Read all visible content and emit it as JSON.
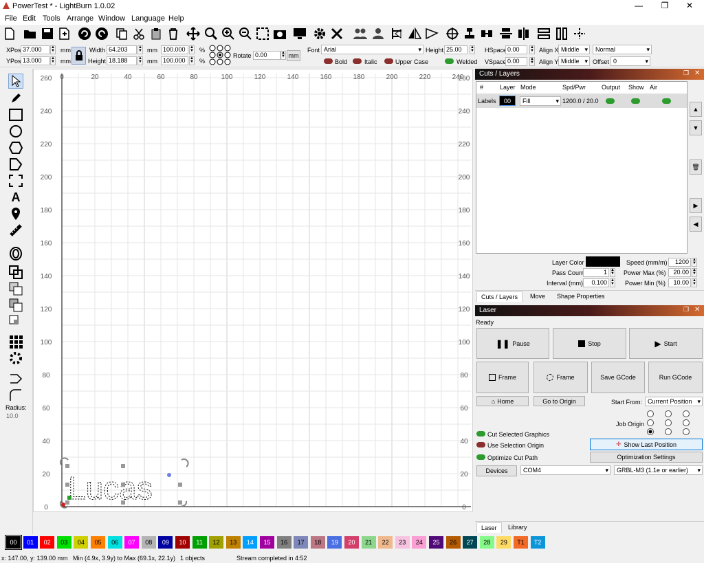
{
  "titlebar": {
    "title": "PowerTest * - LightBurn 1.0.02",
    "minimize": "—",
    "maximize": "❐",
    "close": "✕"
  },
  "menu": [
    "File",
    "Edit",
    "Tools",
    "Arrange",
    "Window",
    "Language",
    "Help"
  ],
  "props": {
    "xpos_label": "XPos",
    "xpos": "37.000",
    "ypos_label": "YPos",
    "ypos": "13.000",
    "unit": "mm",
    "width_label": "Width",
    "width": "64.203",
    "height_label": "Height",
    "height": "18.188",
    "wpct": "100.000",
    "hpct": "100.000",
    "pct": "%",
    "rotate_label": "Rotate",
    "rotate": "0.00",
    "rotate_unit": "mm",
    "font_label": "Font",
    "font": "Arial",
    "fheight_label": "Height",
    "fheight": "25.00",
    "hspace_label": "HSpace",
    "hspace": "0.00",
    "vspace_label": "VSpace",
    "vspace": "0.00",
    "alignx_label": "Align X",
    "alignx": "Middle",
    "aligny_label": "Align Y",
    "aligny": "Middle",
    "normal": "Normal",
    "offset_label": "Offset",
    "offset": "0",
    "bold": "Bold",
    "italic": "Italic",
    "upper": "Upper Case",
    "welded": "Welded"
  },
  "tools": {
    "radius_label": "Radius:",
    "radius": "10.0"
  },
  "axes": {
    "x_ticks": [
      "0",
      "20",
      "40",
      "60",
      "80",
      "100",
      "120",
      "140",
      "160",
      "180",
      "200",
      "220",
      "240"
    ],
    "y_ticks": [
      "260",
      "240",
      "220",
      "200",
      "180",
      "160",
      "140",
      "120",
      "100",
      "80",
      "60",
      "40",
      "20",
      "0"
    ]
  },
  "canvas": {
    "text": "Lucas"
  },
  "cuts": {
    "title": "Cuts / Layers",
    "headers": [
      "#",
      "Layer",
      "Mode",
      "Spd/Pwr",
      "Output",
      "Show",
      "Air"
    ],
    "row": {
      "name": "Labels",
      "layer": "00",
      "mode": "Fill",
      "spdpwr": "1200.0 / 20.0"
    },
    "layer_color_label": "Layer Color",
    "pass_label": "Pass Count",
    "pass": "1",
    "interval_label": "Interval (mm)",
    "interval": "0.100",
    "speed_label": "Speed (mm/m)",
    "speed": "1200",
    "pmax_label": "Power Max (%)",
    "pmax": "20.00",
    "pmin_label": "Power Min (%)",
    "pmin": "10.00",
    "tabs": [
      "Cuts / Layers",
      "Move",
      "Shape Properties"
    ]
  },
  "laser": {
    "title": "Laser",
    "status": "Ready",
    "pause": "Pause",
    "stop": "Stop",
    "start": "Start",
    "frame1": "Frame",
    "frame2": "Frame",
    "save": "Save GCode",
    "run": "Run GCode",
    "home": "Home",
    "origin": "Go to Origin",
    "start_from_label": "Start From:",
    "start_from": "Current Position",
    "job_origin": "Job Origin",
    "cut_selected": "Cut Selected Graphics",
    "use_origin": "Use Selection Origin",
    "optimize": "Optimize Cut Path",
    "show_last": "Show Last Position",
    "opt_settings": "Optimization Settings",
    "devices": "Devices",
    "port": "COM4",
    "device": "GRBL-M3 (1.1e or earlier)",
    "tabs": [
      "Laser",
      "Library"
    ]
  },
  "palette": [
    {
      "l": "00",
      "c": "#000000",
      "t": "#ffffff"
    },
    {
      "l": "01",
      "c": "#0000ff",
      "t": "#ffffff"
    },
    {
      "l": "02",
      "c": "#ff0000",
      "t": "#ffffff"
    },
    {
      "l": "03",
      "c": "#00e000",
      "t": "#000000"
    },
    {
      "l": "04",
      "c": "#d0d000",
      "t": "#000000"
    },
    {
      "l": "05",
      "c": "#ff8000",
      "t": "#000000"
    },
    {
      "l": "06",
      "c": "#00e0e0",
      "t": "#000000"
    },
    {
      "l": "07",
      "c": "#ff00ff",
      "t": "#ffffff"
    },
    {
      "l": "08",
      "c": "#b4b4b4",
      "t": "#000000"
    },
    {
      "l": "09",
      "c": "#0000a0",
      "t": "#ffffff"
    },
    {
      "l": "10",
      "c": "#a00000",
      "t": "#ffffff"
    },
    {
      "l": "11",
      "c": "#00a000",
      "t": "#ffffff"
    },
    {
      "l": "12",
      "c": "#a0a000",
      "t": "#000000"
    },
    {
      "l": "13",
      "c": "#c08000",
      "t": "#000000"
    },
    {
      "l": "14",
      "c": "#00a0ff",
      "t": "#ffffff"
    },
    {
      "l": "15",
      "c": "#a000a0",
      "t": "#ffffff"
    },
    {
      "l": "16",
      "c": "#808080",
      "t": "#000000"
    },
    {
      "l": "17",
      "c": "#7d87b9",
      "t": "#000000"
    },
    {
      "l": "18",
      "c": "#bb7784",
      "t": "#000000"
    },
    {
      "l": "19",
      "c": "#4a6fe3",
      "t": "#ffffff"
    },
    {
      "l": "20",
      "c": "#d33f6a",
      "t": "#ffffff"
    },
    {
      "l": "21",
      "c": "#8cd78c",
      "t": "#000000"
    },
    {
      "l": "22",
      "c": "#f0b98d",
      "t": "#000000"
    },
    {
      "l": "23",
      "c": "#f6c4e1",
      "t": "#000000"
    },
    {
      "l": "24",
      "c": "#fa9ed4",
      "t": "#000000"
    },
    {
      "l": "25",
      "c": "#500a78",
      "t": "#ffffff"
    },
    {
      "l": "26",
      "c": "#b45a00",
      "t": "#000000"
    },
    {
      "l": "27",
      "c": "#004754",
      "t": "#ffffff"
    },
    {
      "l": "28",
      "c": "#86fa88",
      "t": "#000000"
    },
    {
      "l": "29",
      "c": "#ffdb66",
      "t": "#000000"
    },
    {
      "l": "T1",
      "c": "#f36926",
      "t": "#000000"
    },
    {
      "l": "T2",
      "c": "#0c96d9",
      "t": "#ffffff"
    }
  ],
  "status": {
    "coords": "x: 147.00, y: 139.00 mm",
    "range": "Min (4.9x, 3.9y) to Max (69.1x, 22.1y)",
    "objects": "1 objects",
    "stream": "Stream completed in 4:52"
  }
}
